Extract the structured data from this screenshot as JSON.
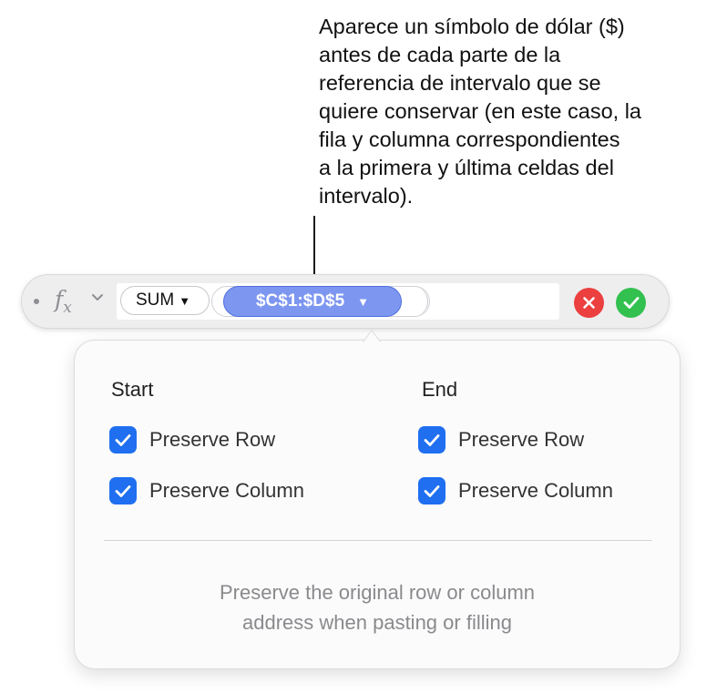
{
  "callout": {
    "lines": [
      "Aparece un símbolo de dólar ($)",
      "antes de cada parte de la",
      "referencia de intervalo que se",
      "quiere conservar (en este caso, la",
      "fila y columna correspondientes",
      "a la primera y última celdas del",
      "intervalo)."
    ]
  },
  "formula_bar": {
    "fx_icon": "function-icon",
    "function_name": "SUM",
    "range_reference": "$C$1:$D$5",
    "cancel_icon": "close-icon",
    "accept_icon": "checkmark-icon"
  },
  "popover": {
    "start": {
      "title": "Start",
      "preserve_row": "Preserve Row",
      "preserve_column": "Preserve Column",
      "preserve_row_checked": true,
      "preserve_column_checked": true
    },
    "end": {
      "title": "End",
      "preserve_row": "Preserve Row",
      "preserve_column": "Preserve Column",
      "preserve_row_checked": true,
      "preserve_column_checked": true
    },
    "help_line1": "Preserve the original row or column",
    "help_line2": "address when pasting or filling"
  },
  "colors": {
    "range_token": "#7d96f0",
    "checkbox": "#1f6ff0",
    "cancel": "#ec3f3f",
    "accept": "#32c04f"
  }
}
